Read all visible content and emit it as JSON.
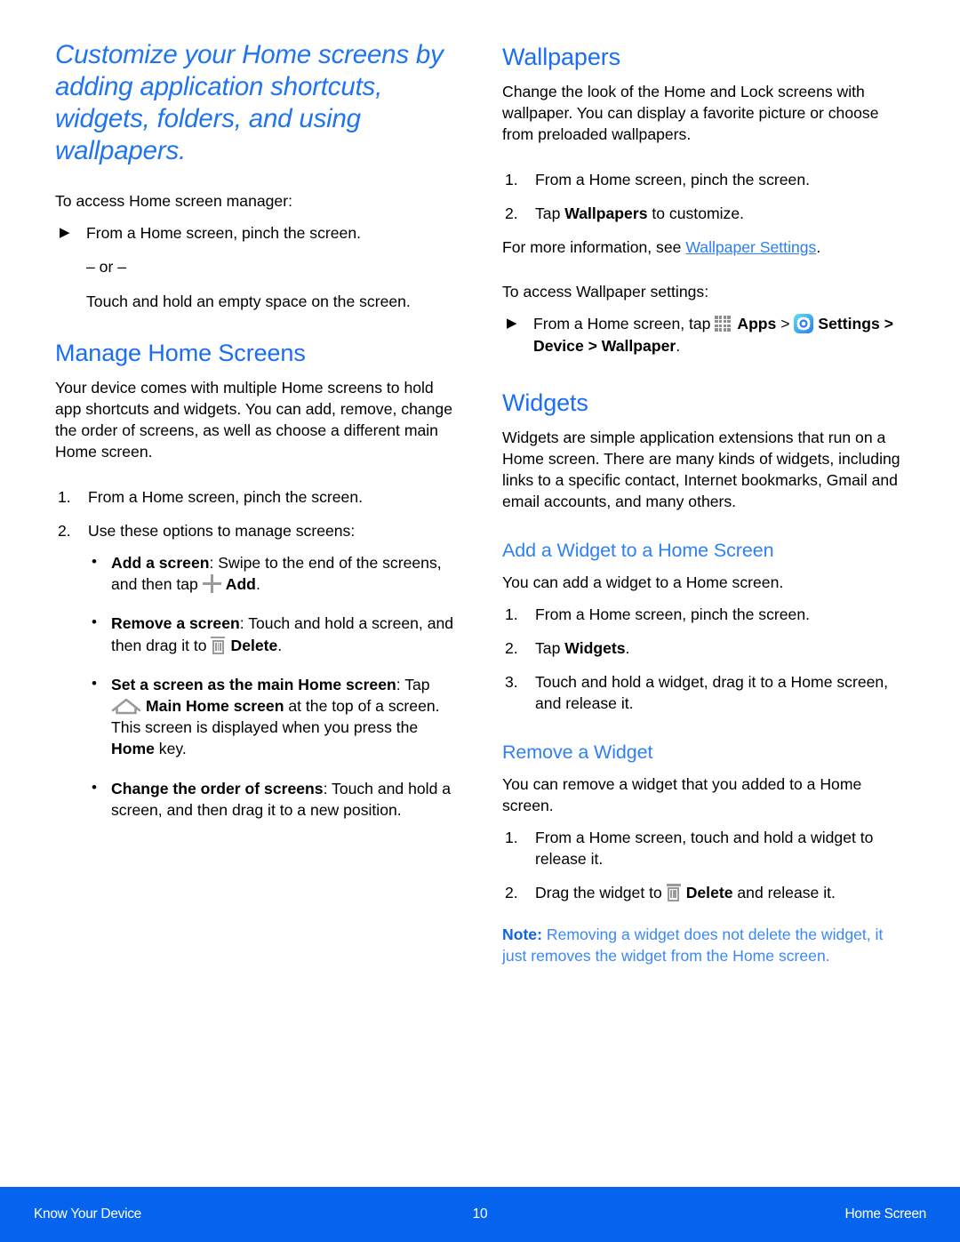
{
  "document": {
    "page_title": "Customize your Home screens by adding application shortcuts, widgets, folders, and using wallpapers."
  },
  "left_column": {
    "title": "Customize your Home screens by adding application shortcuts, widgets, folders, and using wallpapers.",
    "intro_lead": "To access Home screen manager:",
    "intro_step": "From a Home screen, pinch the screen.",
    "intro_or": "– or –",
    "intro_alt": "Touch and hold an empty space on the screen.",
    "manage_heading": "Manage Home Screens",
    "manage_paragraph": "Your device comes with multiple Home screens to hold app shortcuts and widgets. You can add, remove, change the order of screens, as well as choose a different main Home screen.",
    "manage_steps": [
      "From a Home screen, pinch the screen.",
      "Use these options to manage screens:"
    ],
    "options": [
      {
        "label": "Add a screen",
        "text_before": ": Swipe to the end of the screens, and then tap ",
        "icon": "plus-icon",
        "bold_after": "Add",
        "text_after": "."
      },
      {
        "label": "Remove a screen",
        "text_before": ": Touch and hold a screen, and then drag it to ",
        "icon": "trash-icon",
        "bold_after": "Delete",
        "text_after": "."
      },
      {
        "label": "Set a screen as the main Home screen",
        "text_before": ": Tap ",
        "icon": "home-icon",
        "bold_after": "Main Home screen",
        "text_after": " at the top of a screen. This screen is displayed when you press the ",
        "bold_tail": "Home",
        "text_tail": " key."
      },
      {
        "label": "Change the order of screens",
        "text_before": ": Touch and hold a screen, and then drag it to a new position.",
        "icon": null,
        "bold_after": "",
        "text_after": ""
      }
    ]
  },
  "right_column": {
    "wallpapers_heading": "Wallpapers",
    "wallpapers_paragraph": "Change the look of the Home and Lock screens with wallpaper. You can display a favorite picture or choose from preloaded wallpapers.",
    "wallpapers_steps": [
      {
        "text": "From a Home screen, pinch the screen."
      },
      {
        "prefix": "Tap ",
        "bold": "Wallpapers",
        "suffix": " to customize."
      }
    ],
    "more_info_prefix": "For more information, see ",
    "more_info_link": "Wallpaper Settings",
    "more_info_suffix": ".",
    "wallpaper_settings_lead": "To access Wallpaper settings:",
    "wallpaper_settings_step": {
      "prefix": "From a Home screen, tap ",
      "apps_icon": "apps-grid-icon",
      "apps_label": "Apps",
      "separator_1": " > ",
      "settings_icon": "settings-gear-icon",
      "settings_label": "Settings",
      "path_tail": " > Device > Wallpaper",
      "period": "."
    },
    "widgets_heading": "Widgets",
    "widgets_paragraph": "Widgets are simple application extensions that run on a Home screen. There are many kinds of widgets, including links to a specific contact, Internet bookmarks, Gmail and email accounts, and many others.",
    "add_widget_heading": "Add a Widget to a Home Screen",
    "add_widget_intro": "You can add a widget to a Home screen.",
    "add_widget_steps": [
      {
        "text": "From a Home screen, pinch the screen."
      },
      {
        "prefix": "Tap ",
        "bold": "Widgets",
        "suffix": "."
      },
      {
        "text": "Touch and hold a widget, drag it to a Home screen, and release it."
      }
    ],
    "remove_widget_heading": "Remove a Widget",
    "remove_widget_intro": "You can remove a widget that you added to a Home screen.",
    "remove_widget_steps": [
      {
        "text": "From a Home screen, touch and hold a widget to release it."
      },
      {
        "prefix": "Drag the widget to ",
        "icon": "trash-icon",
        "bold": "Delete",
        "suffix": " and release it."
      }
    ],
    "note": {
      "label": "Note",
      "separator": ": ",
      "text": "Removing a widget does not delete the widget, it just removes the widget from the Home screen."
    }
  },
  "footer": {
    "left": "Know Your Device",
    "page_number": "10",
    "right": "Home Screen"
  },
  "colors": {
    "heading_blue": "#1a6ef2",
    "title_blue": "#1f74f0",
    "subheading_blue": "#2f80f5",
    "link_blue": "#2d7df4",
    "note_blue": "#3a88f7",
    "note_label_blue": "#1263e0",
    "footer_blue": "#0663ee",
    "icon_gray": "#9a9a9a"
  }
}
